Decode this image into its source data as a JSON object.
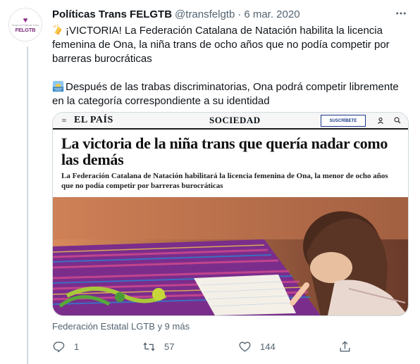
{
  "tweet": {
    "author": {
      "display_name": "Políticas Trans FELGTB",
      "handle": "@transfelgtb",
      "avatar_text": "FELGTB",
      "avatar_small_text": "Grupo de Políticas Trans"
    },
    "separator": "·",
    "date": "6 mar. 2020",
    "paragraph_1": "¡VICTORIA! La Federación Catalana de Natación habilita la licencia femenina de Ona, la niña trans de ocho años que no podía competir por barreras burocráticas",
    "paragraph_2": "Después de las trabas discriminatorias, Ona podrá competir libremente en la categoría correspondiente a su identidad",
    "emoji_1": "clapping-hands",
    "emoji_2": "sunrise-over-water",
    "source": "Federación Estatal LGTB y 9 más",
    "counts": {
      "replies": "1",
      "retweets": "57",
      "likes": "144"
    }
  },
  "card": {
    "masthead": {
      "logo": "EL PAÍS",
      "section": "SOCIEDAD",
      "subscribe": "SUSCRÍBETE"
    },
    "headline": "La victoria de la niña trans que quería nadar como las demás",
    "subhead": "La Federación Catalana de Natación habilitará la licencia femenina de Ona, la menor de ocho años que no podía competir por barreras burocráticas"
  },
  "colors": {
    "text_primary": "#0f1419",
    "text_secondary": "#536471",
    "border": "#cfd9de",
    "brand_purple": "#8e2e8e"
  }
}
